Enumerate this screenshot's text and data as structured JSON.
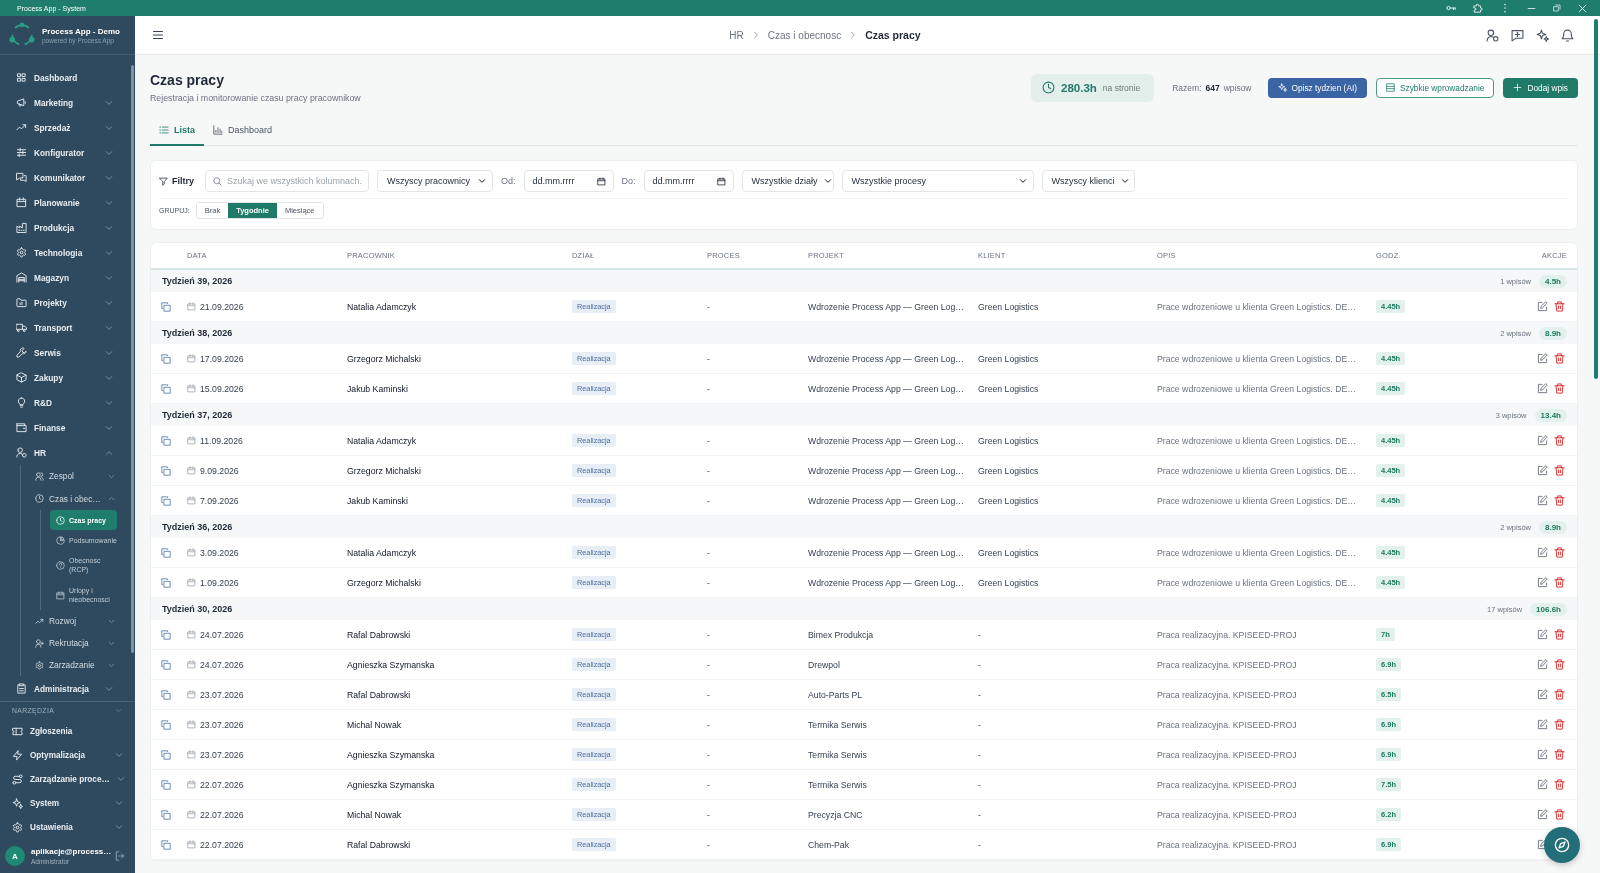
{
  "window": {
    "title": "Process App - System"
  },
  "sidebar": {
    "brand": {
      "name": "Process App - Demo",
      "tagline": "powered by Process App"
    },
    "items": [
      {
        "label": "Dashboard",
        "kind": "link",
        "selected": false
      },
      {
        "label": "Marketing",
        "kind": "group",
        "expanded": false,
        "selected": false
      },
      {
        "label": "Sprzedaż",
        "kind": "group",
        "expanded": false,
        "selected": false
      },
      {
        "label": "Konfigurator",
        "kind": "group",
        "expanded": false,
        "selected": false
      },
      {
        "label": "Komunikator",
        "kind": "group",
        "expanded": false,
        "selected": false
      },
      {
        "label": "Planowanie",
        "kind": "group",
        "expanded": false,
        "selected": false
      },
      {
        "label": "Produkcja",
        "kind": "group",
        "expanded": false,
        "selected": false
      },
      {
        "label": "Technologia",
        "kind": "group",
        "expanded": false,
        "selected": false
      },
      {
        "label": "Magazyn",
        "kind": "group",
        "expanded": false,
        "selected": false
      },
      {
        "label": "Projekty",
        "kind": "group",
        "expanded": false,
        "selected": false
      },
      {
        "label": "Transport",
        "kind": "group",
        "expanded": false,
        "selected": false
      },
      {
        "label": "Serwis",
        "kind": "group",
        "expanded": false,
        "selected": false
      },
      {
        "label": "Zakupy",
        "kind": "group",
        "expanded": false,
        "selected": false
      },
      {
        "label": "R&D",
        "kind": "group",
        "expanded": false,
        "selected": false
      },
      {
        "label": "Finanse",
        "kind": "group",
        "expanded": false,
        "selected": false
      },
      {
        "label": "HR",
        "kind": "group",
        "expanded": true,
        "selected": false,
        "children": [
          {
            "label": "Zespol",
            "kind": "group",
            "expanded": false,
            "selected": false
          },
          {
            "label": "Czas i obec…",
            "kind": "group",
            "expanded": true,
            "selected": false,
            "children": [
              {
                "label": "Czas pracy",
                "kind": "link",
                "selected": true
              },
              {
                "label": "Podsumowanie",
                "kind": "link",
                "selected": false
              },
              {
                "label": "Obecnosc (RCP)",
                "kind": "link",
                "selected": false
              },
              {
                "label": "Urlopy i nieobecnosci",
                "kind": "link",
                "selected": false
              }
            ]
          },
          {
            "label": "Rozwoj",
            "kind": "group",
            "expanded": false,
            "selected": false
          },
          {
            "label": "Rekrutacja",
            "kind": "group",
            "expanded": false,
            "selected": false
          },
          {
            "label": "Zarzadzanie",
            "kind": "group",
            "expanded": false,
            "selected": false
          }
        ]
      },
      {
        "label": "Administracja",
        "kind": "group",
        "expanded": false,
        "selected": false
      }
    ],
    "tools": {
      "label": "NARZĘDZIA",
      "items": [
        {
          "label": "Zgłoszenia",
          "kind": "link",
          "selected": false
        },
        {
          "label": "Optymalizacja",
          "kind": "group",
          "expanded": false,
          "selected": false
        },
        {
          "label": "Zarządzanie proce…",
          "kind": "group",
          "expanded": false,
          "selected": false
        },
        {
          "label": "System",
          "kind": "group",
          "expanded": false,
          "selected": false
        },
        {
          "label": "Ustawienia",
          "kind": "group",
          "expanded": false,
          "selected": false
        }
      ]
    },
    "user": {
      "initial": "A",
      "email": "aplikacje@process…",
      "role": "Administrator"
    }
  },
  "header": {
    "breadcrumb": [
      "HR",
      "Czas i obecnosc",
      "Czas pracy"
    ]
  },
  "page": {
    "title": "Czas pracy",
    "subtitle": "Rejestracja i monitorowanie czasu pracy pracownikow",
    "stats": {
      "hours": "280.3h",
      "hours_label": "na stronie",
      "total_label": "Razem:",
      "total": "647",
      "total_unit": "wpisow"
    },
    "actions": [
      {
        "label": "Opisz tydzien (AI)",
        "kind": "ai"
      },
      {
        "label": "Szybkie wprowadzanie",
        "kind": "outline"
      },
      {
        "label": "Dodaj wpis",
        "kind": "primary"
      }
    ],
    "tabs": [
      {
        "label": "Lista",
        "selected": true
      },
      {
        "label": "Dashboard",
        "selected": false
      }
    ]
  },
  "filters": {
    "label": "Filtry",
    "search": {
      "placeholder": "Szukaj we wszystkich kolumnach."
    },
    "employee": {
      "value": "Wszyscy pracownicy"
    },
    "date_from": {
      "label": "Od:",
      "placeholder": "dd.mm.rrrr"
    },
    "date_to": {
      "label": "Do:",
      "placeholder": "dd.mm.rrrr"
    },
    "department": {
      "value": "Wszystkie działy"
    },
    "process": {
      "value": "Wszystkie procesy"
    },
    "client": {
      "value": "Wszyscy klienci"
    },
    "group_by": {
      "label": "GRUPUJ:",
      "options": [
        {
          "label": "Brak",
          "selected": false
        },
        {
          "label": "Tygodnie",
          "selected": true
        },
        {
          "label": "Miesiące",
          "selected": false
        }
      ]
    }
  },
  "table": {
    "columns": [
      "DATA",
      "PRACOWNIK",
      "DZIAŁ",
      "PROCES",
      "PROJEKT",
      "KLIENT",
      "OPIS",
      "GODZ.",
      "AKCJE"
    ],
    "groups": [
      {
        "label": "Tydzień 39, 2026",
        "count": "1 wpisów",
        "total": "4.5h",
        "rows": [
          {
            "date": "21.09.2026",
            "employee": "Natalia Adamczyk",
            "department": "Realizacja",
            "process": "-",
            "project": "Wdrozenie Process App — Green Log…",
            "client": "Green Logistics",
            "description": "Prace wdrozeniowe u klienta Green Logistics. DE…",
            "hours": "4.45h"
          }
        ]
      },
      {
        "label": "Tydzień 38, 2026",
        "count": "2 wpisów",
        "total": "8.9h",
        "rows": [
          {
            "date": "17.09.2026",
            "employee": "Grzegorz Michalski",
            "department": "Realizacja",
            "process": "-",
            "project": "Wdrozenie Process App — Green Log…",
            "client": "Green Logistics",
            "description": "Prace wdrozeniowe u klienta Green Logistics. DE…",
            "hours": "4.45h"
          },
          {
            "date": "15.09.2026",
            "employee": "Jakub Kaminski",
            "department": "Realizacja",
            "process": "-",
            "project": "Wdrozenie Process App — Green Log…",
            "client": "Green Logistics",
            "description": "Prace wdrozeniowe u klienta Green Logistics. DE…",
            "hours": "4.45h"
          }
        ]
      },
      {
        "label": "Tydzień 37, 2026",
        "count": "3 wpisów",
        "total": "13.4h",
        "rows": [
          {
            "date": "11.09.2026",
            "employee": "Natalia Adamczyk",
            "department": "Realizacja",
            "process": "-",
            "project": "Wdrozenie Process App — Green Log…",
            "client": "Green Logistics",
            "description": "Prace wdrozeniowe u klienta Green Logistics. DE…",
            "hours": "4.45h"
          },
          {
            "date": "9.09.2026",
            "employee": "Grzegorz Michalski",
            "department": "Realizacja",
            "process": "-",
            "project": "Wdrozenie Process App — Green Log…",
            "client": "Green Logistics",
            "description": "Prace wdrozeniowe u klienta Green Logistics. DE…",
            "hours": "4.45h"
          },
          {
            "date": "7.09.2026",
            "employee": "Jakub Kaminski",
            "department": "Realizacja",
            "process": "-",
            "project": "Wdrozenie Process App — Green Log…",
            "client": "Green Logistics",
            "description": "Prace wdrozeniowe u klienta Green Logistics. DE…",
            "hours": "4.45h"
          }
        ]
      },
      {
        "label": "Tydzień 36, 2026",
        "count": "2 wpisów",
        "total": "8.9h",
        "rows": [
          {
            "date": "3.09.2026",
            "employee": "Natalia Adamczyk",
            "department": "Realizacja",
            "process": "-",
            "project": "Wdrozenie Process App — Green Log…",
            "client": "Green Logistics",
            "description": "Prace wdrozeniowe u klienta Green Logistics. DE…",
            "hours": "4.45h"
          },
          {
            "date": "1.09.2026",
            "employee": "Grzegorz Michalski",
            "department": "Realizacja",
            "process": "-",
            "project": "Wdrozenie Process App — Green Log…",
            "client": "Green Logistics",
            "description": "Prace wdrozeniowe u klienta Green Logistics. DE…",
            "hours": "4.45h"
          }
        ]
      },
      {
        "label": "Tydzień 30, 2026",
        "count": "17 wpisów",
        "total": "106.6h",
        "rows": [
          {
            "date": "24.07.2026",
            "employee": "Rafal Dabrowski",
            "department": "Realizacja",
            "process": "-",
            "project": "Bimex Produkcja",
            "client": "-",
            "description": "Praca realizacyjna. KPISEED-PROJ",
            "hours": "7h"
          },
          {
            "date": "24.07.2026",
            "employee": "Agnieszka Szymanska",
            "department": "Realizacja",
            "process": "-",
            "project": "Drewpol",
            "client": "-",
            "description": "Praca realizacyjna. KPISEED-PROJ",
            "hours": "6.9h"
          },
          {
            "date": "23.07.2026",
            "employee": "Rafal Dabrowski",
            "department": "Realizacja",
            "process": "-",
            "project": "Auto-Parts PL",
            "client": "-",
            "description": "Praca realizacyjna. KPISEED-PROJ",
            "hours": "6.5h"
          },
          {
            "date": "23.07.2026",
            "employee": "Michal Nowak",
            "department": "Realizacja",
            "process": "-",
            "project": "Termika Serwis",
            "client": "-",
            "description": "Praca realizacyjna. KPISEED-PROJ",
            "hours": "6.9h"
          },
          {
            "date": "23.07.2026",
            "employee": "Agnieszka Szymanska",
            "department": "Realizacja",
            "process": "-",
            "project": "Termika Serwis",
            "client": "-",
            "description": "Praca realizacyjna. KPISEED-PROJ",
            "hours": "6.9h"
          },
          {
            "date": "22.07.2026",
            "employee": "Agnieszka Szymanska",
            "department": "Realizacja",
            "process": "-",
            "project": "Termika Serwis",
            "client": "-",
            "description": "Praca realizacyjna. KPISEED-PROJ",
            "hours": "7.5h"
          },
          {
            "date": "22.07.2026",
            "employee": "Michal Nowak",
            "department": "Realizacja",
            "process": "-",
            "project": "Precyzja CNC",
            "client": "-",
            "description": "Praca realizacyjna. KPISEED-PROJ",
            "hours": "6.2h"
          },
          {
            "date": "22.07.2026",
            "employee": "Rafal Dabrowski",
            "department": "Realizacja",
            "process": "-",
            "project": "Chem-Pak",
            "client": "-",
            "description": "Praca realizacyjna. KPISEED-PROJ",
            "hours": "6.9h"
          }
        ]
      }
    ]
  }
}
